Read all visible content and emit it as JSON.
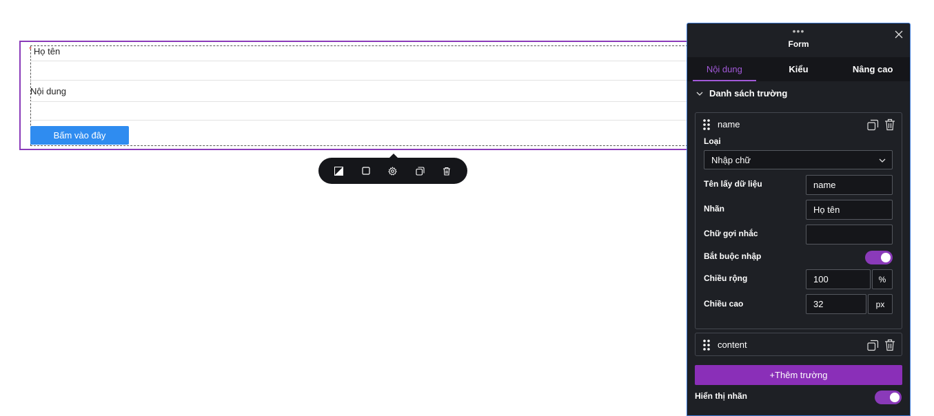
{
  "canvas": {
    "fields": [
      {
        "label": "Họ tên",
        "required_mark": "*"
      },
      {
        "label": "Nội dung"
      }
    ],
    "submit_label": "Bấm vào đây"
  },
  "toolbar": {
    "icons": [
      "style-icon",
      "box-icon",
      "settings-icon",
      "duplicate-icon",
      "delete-icon"
    ]
  },
  "panel": {
    "dots": "•••",
    "title": "Form",
    "tabs": [
      {
        "label": "Nội dung",
        "active": true
      },
      {
        "label": "Kiểu",
        "active": false
      },
      {
        "label": "Nâng cao",
        "active": false
      }
    ],
    "section_title": "Danh sách trường",
    "field_items": [
      {
        "name": "name",
        "type_label": "Loại",
        "type_value": "Nhập chữ",
        "data_name_label": "Tên lấy dữ liệu",
        "data_name_value": "name",
        "label_label": "Nhãn",
        "label_value": "Họ tên",
        "placeholder_label": "Chữ gợi nhắc",
        "placeholder_value": "",
        "required_label": "Bắt buộc nhập",
        "required_on": true,
        "width_label": "Chiều rộng",
        "width_value": "100",
        "width_unit": "%",
        "height_label": "Chiều cao",
        "height_value": "32",
        "height_unit": "px"
      },
      {
        "name": "content"
      }
    ],
    "add_field_label": "Thêm trường",
    "add_field_plus": "+",
    "show_label_text": "Hiển thị nhãn",
    "show_label_on": true
  },
  "colors": {
    "accent": "#8a3ab9",
    "button_blue": "#2f8cf0",
    "panel_bg": "#1e2025"
  }
}
